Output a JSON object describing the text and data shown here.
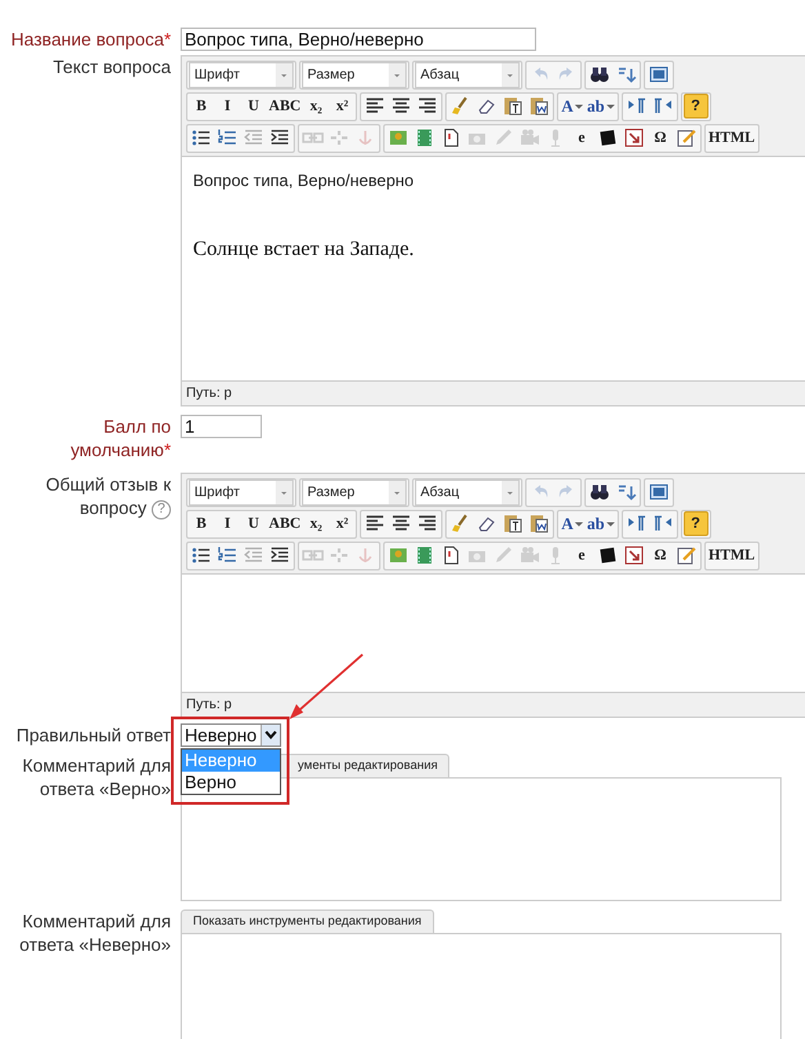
{
  "fields": [
    {
      "kind": "text",
      "label": "Название вопроса",
      "required_mark": "*",
      "value": "Вопрос типа, Верно/неверно"
    },
    {
      "kind": "editor",
      "label": "Текст вопроса",
      "toolbar": [
        [
          [
            {
              "kind": "select",
              "label": "Шрифт"
            }
          ],
          [
            {
              "kind": "select",
              "label": "Размер"
            }
          ],
          [
            {
              "kind": "select",
              "label": "Абзац"
            }
          ],
          [
            {
              "kind": "icon",
              "disabled": true
            },
            {
              "kind": "icon",
              "disabled": true
            }
          ],
          [
            {
              "kind": "icon",
              "disabled": false
            },
            {
              "kind": "icon",
              "disabled": false
            }
          ],
          [
            {
              "kind": "icon",
              "disabled": false
            }
          ]
        ],
        [
          [
            {
              "kind": "text",
              "label": "B"
            },
            {
              "kind": "text",
              "label": "I"
            },
            {
              "kind": "text",
              "label": "U"
            },
            {
              "kind": "text",
              "label": "ABC"
            },
            {
              "kind": "text",
              "label": "x₂"
            },
            {
              "kind": "text",
              "label": "x²"
            }
          ],
          [
            {
              "kind": "icon",
              "disabled": false
            },
            {
              "kind": "icon",
              "disabled": false
            },
            {
              "kind": "icon",
              "disabled": false
            }
          ],
          [
            {
              "kind": "icon",
              "disabled": false
            },
            {
              "kind": "icon",
              "disabled": false
            },
            {
              "kind": "icon",
              "disabled": false
            },
            {
              "kind": "icon",
              "disabled": false
            }
          ],
          [
            {
              "kind": "split",
              "label": "A"
            },
            {
              "kind": "split",
              "label": "ab"
            }
          ],
          [
            {
              "kind": "icon",
              "disabled": false
            },
            {
              "kind": "icon",
              "disabled": false
            }
          ],
          [
            {
              "kind": "help",
              "label": "?"
            }
          ]
        ],
        [
          [
            {
              "kind": "icon",
              "disabled": false
            },
            {
              "kind": "icon",
              "disabled": false
            },
            {
              "kind": "icon",
              "disabled": true
            },
            {
              "kind": "icon",
              "disabled": false
            }
          ],
          [
            {
              "kind": "icon",
              "disabled": true
            },
            {
              "kind": "icon",
              "disabled": true
            },
            {
              "kind": "icon",
              "disabled": true
            }
          ],
          [
            {
              "kind": "icon",
              "disabled": false
            },
            {
              "kind": "icon",
              "disabled": false
            },
            {
              "kind": "icon",
              "disabled": false
            },
            {
              "kind": "icon",
              "disabled": true
            },
            {
              "kind": "icon",
              "disabled": true
            },
            {
              "kind": "icon",
              "disabled": true
            },
            {
              "kind": "icon",
              "disabled": true
            },
            {
              "kind": "text",
              "label": "e"
            },
            {
              "kind": "icon",
              "disabled": false
            },
            {
              "kind": "icon",
              "disabled": false
            },
            {
              "kind": "text",
              "label": "Ω"
            },
            {
              "kind": "icon",
              "disabled": false
            }
          ],
          [
            {
              "kind": "text",
              "label": "HTML"
            }
          ]
        ]
      ],
      "content": [
        {
          "kind": "plain",
          "text": "Вопрос типа, Верно/неверно"
        },
        {
          "kind": "serif",
          "text": "Солнце встает на Западе."
        }
      ],
      "path": "Путь: p"
    },
    {
      "kind": "short",
      "label": "Балл по умолчанию",
      "required_mark": "*",
      "value": "1"
    },
    {
      "kind": "editor",
      "label": "Общий отзыв к вопросу",
      "help": "?",
      "toolbar": [
        [
          [
            {
              "kind": "select",
              "label": "Шрифт"
            }
          ],
          [
            {
              "kind": "select",
              "label": "Размер"
            }
          ],
          [
            {
              "kind": "select",
              "label": "Абзац"
            }
          ],
          [
            {
              "kind": "icon",
              "disabled": true
            },
            {
              "kind": "icon",
              "disabled": true
            }
          ],
          [
            {
              "kind": "icon",
              "disabled": false
            },
            {
              "kind": "icon",
              "disabled": false
            }
          ],
          [
            {
              "kind": "icon",
              "disabled": false
            }
          ]
        ],
        [
          [
            {
              "kind": "text",
              "label": "B"
            },
            {
              "kind": "text",
              "label": "I"
            },
            {
              "kind": "text",
              "label": "U"
            },
            {
              "kind": "text",
              "label": "ABC"
            },
            {
              "kind": "text",
              "label": "x₂"
            },
            {
              "kind": "text",
              "label": "x²"
            }
          ],
          [
            {
              "kind": "icon",
              "disabled": false
            },
            {
              "kind": "icon",
              "disabled": false
            },
            {
              "kind": "icon",
              "disabled": false
            }
          ],
          [
            {
              "kind": "icon",
              "disabled": false
            },
            {
              "kind": "icon",
              "disabled": false
            },
            {
              "kind": "icon",
              "disabled": false
            },
            {
              "kind": "icon",
              "disabled": false
            }
          ],
          [
            {
              "kind": "split",
              "label": "A"
            },
            {
              "kind": "split",
              "label": "ab"
            }
          ],
          [
            {
              "kind": "icon",
              "disabled": false
            },
            {
              "kind": "icon",
              "disabled": false
            }
          ],
          [
            {
              "kind": "help",
              "label": "?"
            }
          ]
        ],
        [
          [
            {
              "kind": "icon",
              "disabled": false
            },
            {
              "kind": "icon",
              "disabled": false
            },
            {
              "kind": "icon",
              "disabled": true
            },
            {
              "kind": "icon",
              "disabled": false
            }
          ],
          [
            {
              "kind": "icon",
              "disabled": true
            },
            {
              "kind": "icon",
              "disabled": true
            },
            {
              "kind": "icon",
              "disabled": true
            }
          ],
          [
            {
              "kind": "icon",
              "disabled": false
            },
            {
              "kind": "icon",
              "disabled": false
            },
            {
              "kind": "icon",
              "disabled": false
            },
            {
              "kind": "icon",
              "disabled": true
            },
            {
              "kind": "icon",
              "disabled": true
            },
            {
              "kind": "icon",
              "disabled": true
            },
            {
              "kind": "icon",
              "disabled": true
            },
            {
              "kind": "text",
              "label": "e"
            },
            {
              "kind": "icon",
              "disabled": false
            },
            {
              "kind": "icon",
              "disabled": false
            },
            {
              "kind": "text",
              "label": "Ω"
            },
            {
              "kind": "icon",
              "disabled": false
            }
          ],
          [
            {
              "kind": "text",
              "label": "HTML"
            }
          ]
        ]
      ],
      "path": "Путь: p"
    },
    {
      "kind": "select",
      "label": "Правильный ответ",
      "value": "Неверно",
      "expanded": true,
      "highlighted": true,
      "options": [
        {
          "label": "Неверно",
          "selected": true
        },
        {
          "label": "Верно",
          "selected": false
        }
      ]
    },
    {
      "kind": "collapsed",
      "label": "Комментарий для ответа «Верно»",
      "tab": "ументы редактирования"
    },
    {
      "kind": "collapsed",
      "label": "Комментарий для ответа «Неверно»",
      "tab": "Показать инструменты редактирования"
    }
  ]
}
